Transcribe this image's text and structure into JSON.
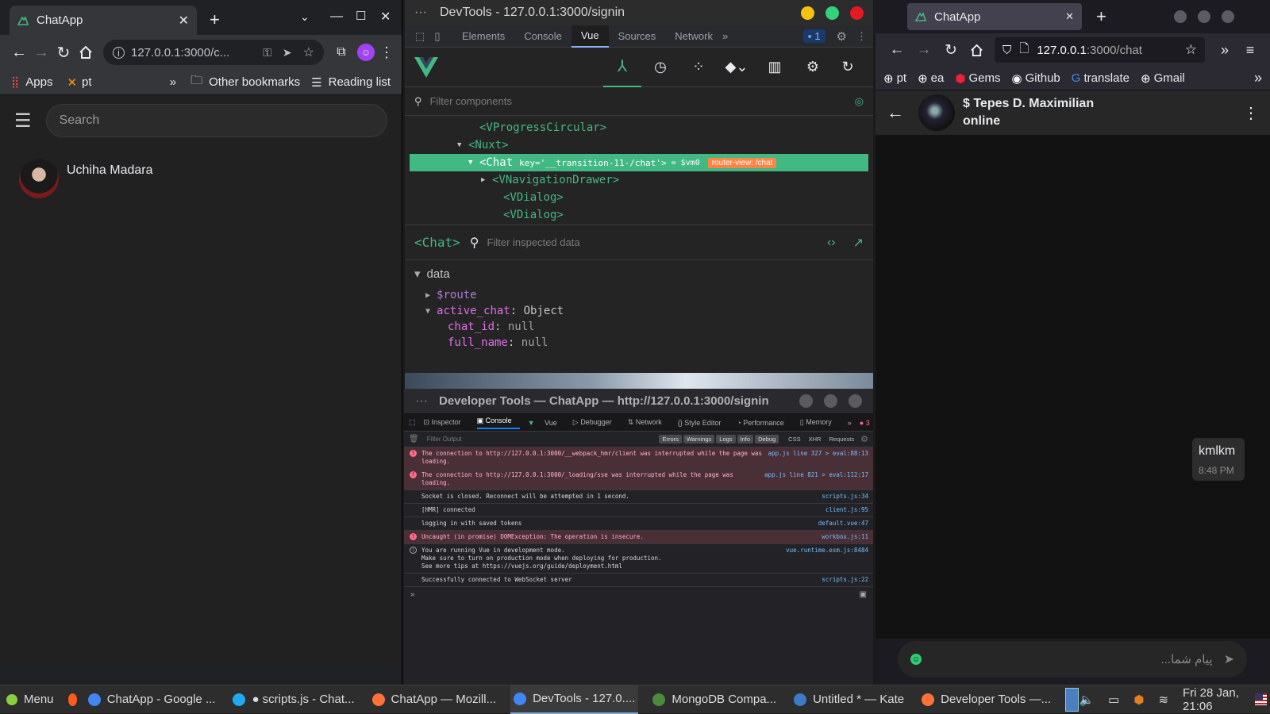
{
  "left_browser": {
    "tab_title": "ChatApp",
    "url": "127.0.0.1:3000/c...",
    "bookmarks": [
      "Apps",
      "pt"
    ],
    "other_bookmarks": "Other bookmarks",
    "reading_list": "Reading list",
    "search_placeholder": "Search",
    "chats": [
      {
        "name": "Uchiha Madara"
      }
    ]
  },
  "devtools": {
    "window_title": "DevTools - 127.0.0.1:3000/signin",
    "tabs": [
      "Elements",
      "Console",
      "Vue",
      "Sources",
      "Network"
    ],
    "active_tab": "Vue",
    "issues_count": "1",
    "filter_placeholder": "Filter components",
    "tree": [
      {
        "indent": 80,
        "arrow": "",
        "label": "<VProgressCircular>"
      },
      {
        "indent": 66,
        "arrow": "▼",
        "label": "<Nuxt>"
      },
      {
        "indent": 80,
        "arrow": "▼",
        "label": "<Chat",
        "key": "key='__transition-11-/chat'>",
        "vm": "= $vm0",
        "badge": "router-view: /chat",
        "selected": true
      },
      {
        "indent": 96,
        "arrow": "▶",
        "label": "<VNavigationDrawer>"
      },
      {
        "indent": 110,
        "arrow": "",
        "label": "<VDialog>"
      },
      {
        "indent": 110,
        "arrow": "",
        "label": "<VDialog>"
      }
    ],
    "inspected": "<Chat>",
    "inspect_filter_placeholder": "Filter inspected data",
    "data_section": "data",
    "data": {
      "route": "$route",
      "active_chat_key": "active_chat",
      "active_chat_type": "Object",
      "fields": [
        {
          "key": "chat_id",
          "value": "null"
        },
        {
          "key": "full_name",
          "value": "null"
        }
      ]
    }
  },
  "ff_devtools": {
    "window_title": "Developer Tools — ChatApp — http://127.0.0.1:3000/signin",
    "tabs": [
      "Inspector",
      "Console",
      "Vue",
      "Debugger",
      "Network",
      "Style Editor",
      "Performance",
      "Memory"
    ],
    "active_tab": "Console",
    "error_count": "3",
    "filter_placeholder": "Filter Output",
    "filters": [
      "Errors",
      "Warnings",
      "Logs",
      "Info",
      "Debug"
    ],
    "filters_plain": [
      "CSS",
      "XHR",
      "Requests"
    ],
    "logs": [
      {
        "type": "error",
        "text": "The connection to http://127.0.0.1:3000/__webpack_hmr/client was interrupted while the page was loading.",
        "src": "app.js line 327 > eval:88:13"
      },
      {
        "type": "error",
        "text": "The connection to http://127.0.0.1:3000/_loading/sse was interrupted while the page was loading.",
        "src": "app.js line 821 > eval:112:17"
      },
      {
        "type": "log",
        "text": "Socket is closed. Reconnect will be attempted in 1 second.",
        "src": "scripts.js:34"
      },
      {
        "type": "log",
        "text": "[HMR] connected",
        "src": "client.js:95"
      },
      {
        "type": "log",
        "text": "logging in with saved tokens",
        "src": "default.vue:47"
      },
      {
        "type": "error",
        "text": "Uncaught (in promise) DOMException: The operation is insecure.",
        "src": "workbox.js:11"
      },
      {
        "type": "info",
        "text": "You are running Vue in development mode.\nMake sure to turn on production mode when deploying for production.\nSee more tips at https://vuejs.org/guide/deployment.html",
        "src": "vue.runtime.esm.js:8484"
      },
      {
        "type": "log",
        "text": "Successfully connected to WebSocket server",
        "src": "scripts.js:22"
      }
    ],
    "prompt": "»"
  },
  "right_browser": {
    "tab_title": "ChatApp",
    "url_host": "127.0.0.1",
    "url_path": ":3000/chat",
    "bookmarks": [
      "pt",
      "ea",
      "Gems",
      "Github",
      "translate",
      "Gmail"
    ],
    "contact_name": "$ Tepes D. Maximilian",
    "contact_status": "online",
    "message": {
      "text": "kmlkm",
      "time": "8:48 PM"
    },
    "input_placeholder": "...پیام شما"
  },
  "taskbar": {
    "menu": "Menu",
    "items": [
      {
        "label": "ChatApp - Google ...",
        "color": "#4285f4"
      },
      {
        "label": "● scripts.js - Chat...",
        "color": "#23a9f2"
      },
      {
        "label": "ChatApp — Mozill...",
        "color": "#ff7139"
      },
      {
        "label": "DevTools - 127.0....",
        "color": "#4285f4",
        "active": true
      },
      {
        "label": "MongoDB Compa...",
        "color": "#4b8b3b"
      },
      {
        "label": "Untitled * — Kate",
        "color": "#3d7ac7"
      },
      {
        "label": "Developer Tools —...",
        "color": "#ff7139"
      }
    ],
    "clock": "Fri 28 Jan, 21:06"
  },
  "colors": {
    "vue_green": "#42b883",
    "badge_orange": "#ff8344",
    "error_bg": "#4b2f36"
  }
}
